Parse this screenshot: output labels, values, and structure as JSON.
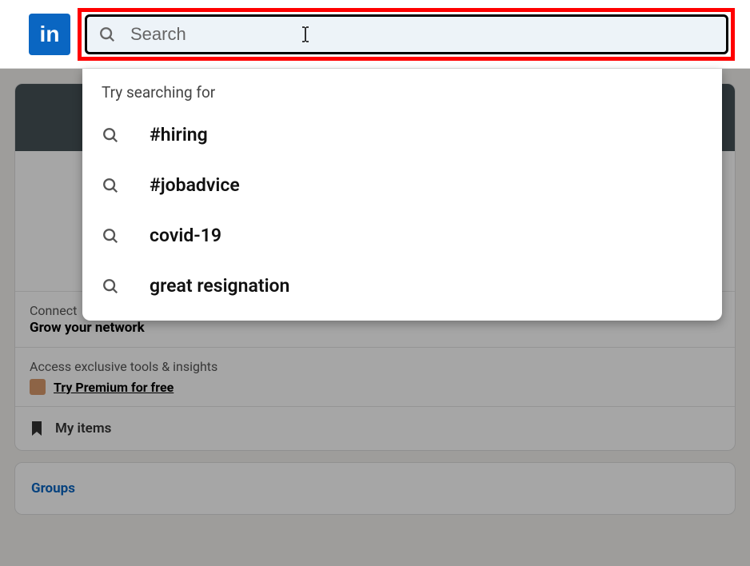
{
  "logo": {
    "text": "in"
  },
  "search": {
    "placeholder": "Search"
  },
  "dropdown": {
    "title": "Try searching for",
    "suggestions": [
      {
        "text": "#hiring"
      },
      {
        "text": "#jobadvice"
      },
      {
        "text": "covid-19"
      },
      {
        "text": "great resignation"
      }
    ]
  },
  "sidebar": {
    "connections_label": "Connect",
    "grow_network": "Grow your network",
    "premium_label": "Access exclusive tools & insights",
    "premium_link": "Try Premium for free",
    "my_items": "My items",
    "groups": "Groups"
  }
}
